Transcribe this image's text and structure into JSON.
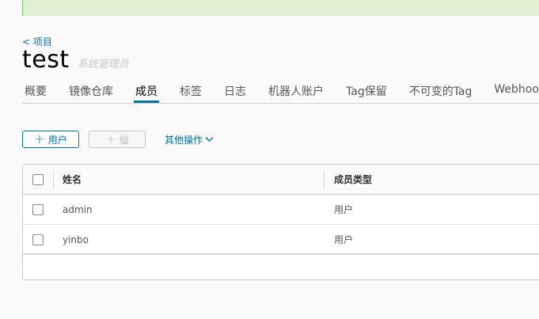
{
  "breadcrumb": {
    "label": "< 项目"
  },
  "project": {
    "name": "test",
    "role": "系统管理员"
  },
  "tabs": [
    {
      "label": "概要"
    },
    {
      "label": "镜像仓库"
    },
    {
      "label": "成员"
    },
    {
      "label": "标签"
    },
    {
      "label": "日志"
    },
    {
      "label": "机器人账户"
    },
    {
      "label": "Tag保留"
    },
    {
      "label": "不可变的Tag"
    },
    {
      "label": "Webhooks"
    }
  ],
  "active_tab": "成员",
  "toolbar": {
    "add_user_label": "用户",
    "add_group_label": "组",
    "more_actions_label": "其他操作"
  },
  "table": {
    "columns": [
      "姓名",
      "成员类型"
    ],
    "rows": [
      {
        "name": "admin",
        "type": "用户"
      },
      {
        "name": "yinbo",
        "type": "用户"
      }
    ]
  },
  "colors": {
    "accent": "#0072a3",
    "banner": "#dff0d0"
  }
}
